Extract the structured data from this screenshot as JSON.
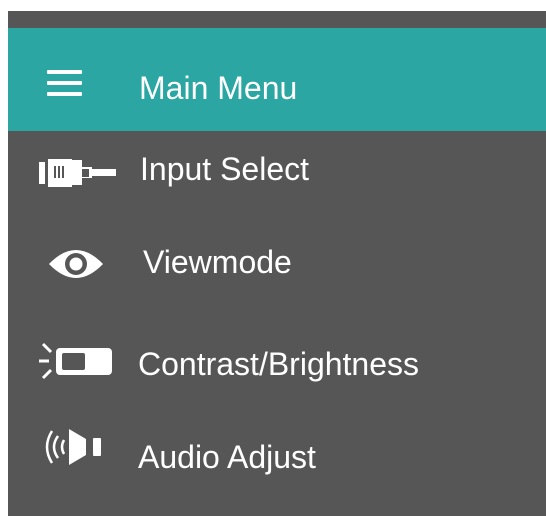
{
  "colors": {
    "panel_bg": "#575656",
    "header_bg": "#2ba6a2",
    "text": "#ffffff"
  },
  "header": {
    "icon": "hamburger-menu-icon",
    "title": "Main Menu"
  },
  "menu": {
    "items": [
      {
        "label": "Input Select",
        "icon": "input-connector-icon"
      },
      {
        "label": "Viewmode",
        "icon": "eye-icon"
      },
      {
        "label": "Contrast/Brightness",
        "icon": "contrast-brightness-icon"
      },
      {
        "label": "Audio Adjust",
        "icon": "speaker-icon"
      }
    ]
  }
}
